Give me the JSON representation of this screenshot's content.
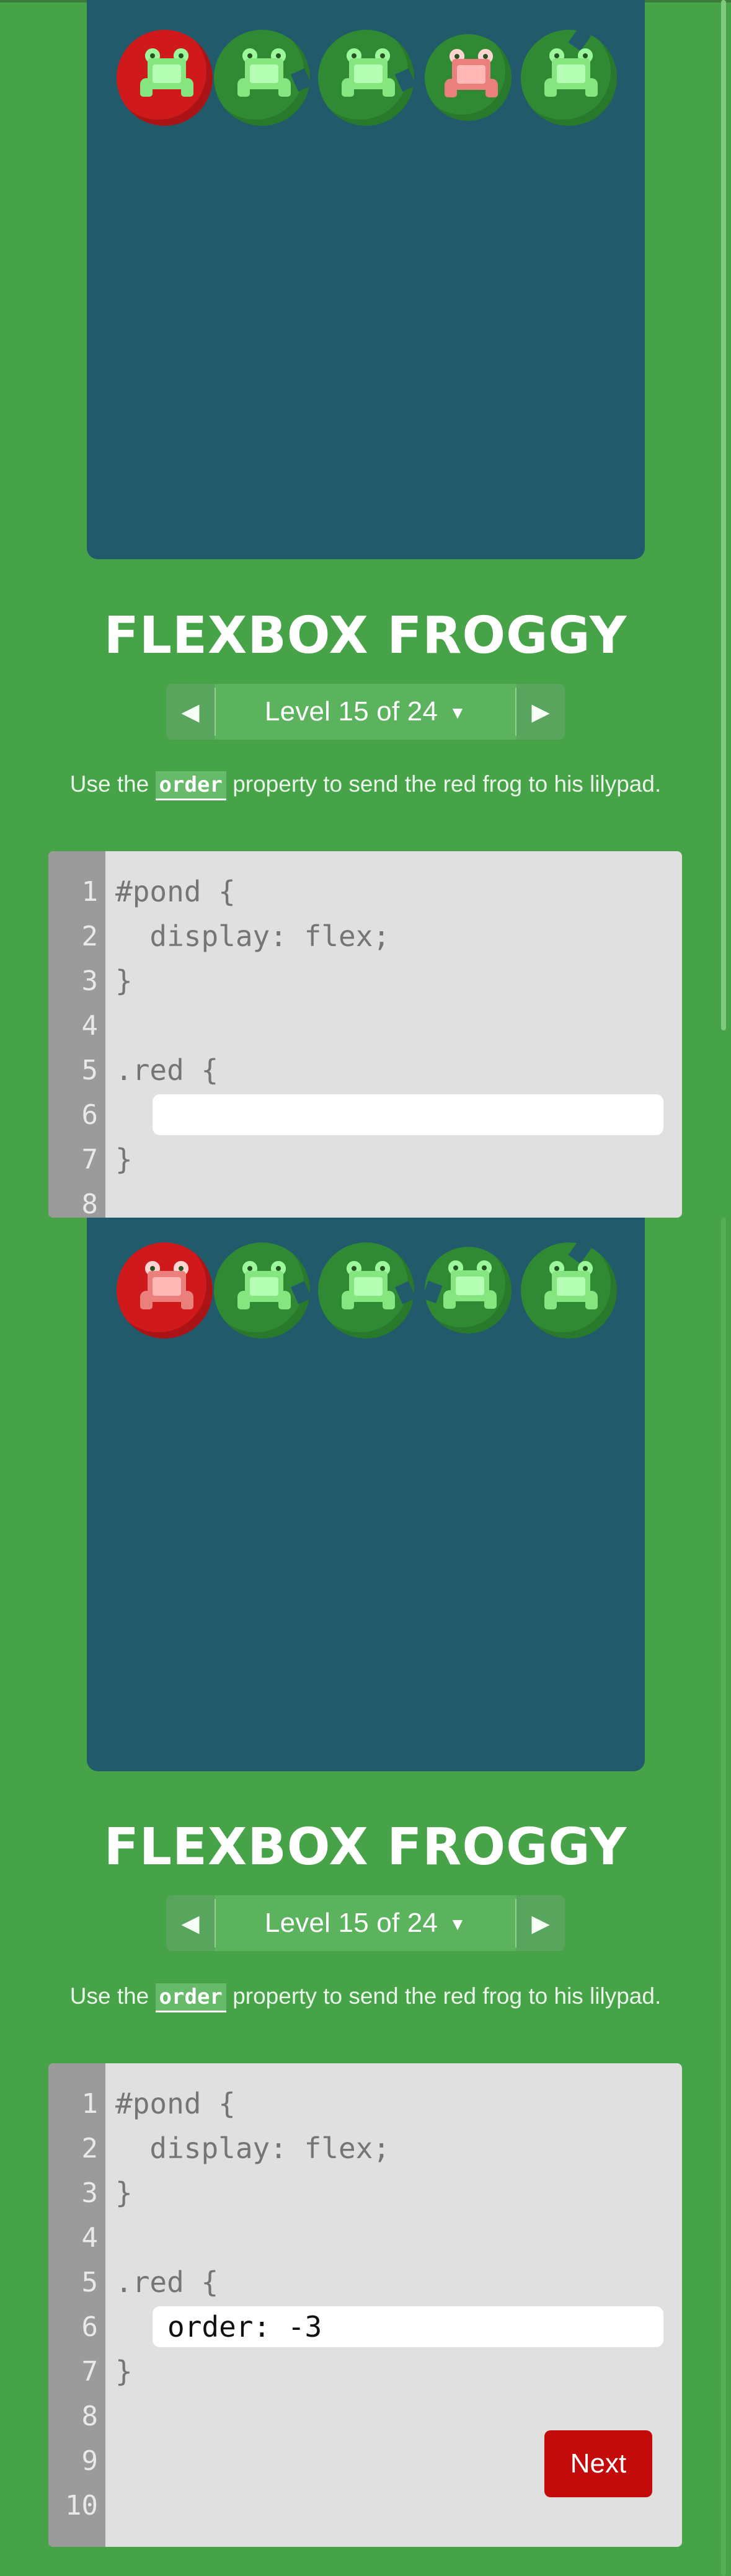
{
  "app": {
    "title": "FLEXBOX FROGGY",
    "level_label": "Level 15 of 24",
    "level_dropdown_glyph": "▼",
    "prev_glyph": "◀",
    "next_glyph": "▶"
  },
  "instruction": {
    "before": "Use the ",
    "code": "order",
    "after": " property to send the red frog to his lilypad."
  },
  "editor": {
    "lines": [
      {
        "num": "1",
        "text": "#pond {"
      },
      {
        "num": "2",
        "text": "  display: flex;"
      },
      {
        "num": "3",
        "text": "}"
      },
      {
        "num": "4",
        "text": ""
      },
      {
        "num": "5",
        "text": ".red {"
      },
      {
        "num": "6",
        "text": ""
      },
      {
        "num": "7",
        "text": "}"
      },
      {
        "num": "8",
        "text": ""
      },
      {
        "num": "9",
        "text": ""
      },
      {
        "num": "10",
        "text": ""
      }
    ],
    "first_panel_input_value": "",
    "second_panel_input_value": "order: -3",
    "next_button_label": "Next"
  },
  "colors": {
    "background": "#47a348",
    "pond": "#215a6b",
    "lilypad_green": "#2f8a33",
    "lilypad_red": "#d0191b",
    "next_button": "#c40b0b"
  }
}
